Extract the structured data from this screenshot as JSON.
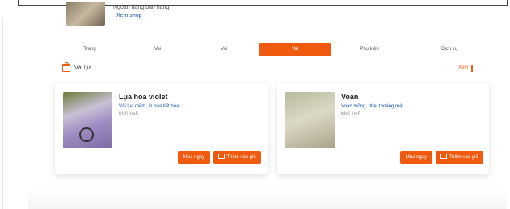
{
  "header": {
    "shop_name": "Ngoan dang ban hang",
    "shop_link": "Xem shop"
  },
  "tabs": [
    {
      "label": "Trang"
    },
    {
      "label": "Vai"
    },
    {
      "label": "Vai"
    },
    {
      "label": "Vai"
    },
    {
      "label": "Phụ kiện"
    },
    {
      "label": "Dịch vụ"
    }
  ],
  "section": {
    "title": "Vải lụa",
    "view_more": "Xem"
  },
  "products": [
    {
      "title": "Lụa hoa violet",
      "desc_line1": "Vải lụa mềm, in họa tiết hoa",
      "desc_line2": "Khổ 1m5",
      "buy_label": "Mua ngay",
      "cart_label": "Thêm vào giỏ"
    },
    {
      "title": "Voan",
      "desc_line1": "Voan mỏng, nhẹ, thoáng mát",
      "desc_line2": "Khổ 1m5",
      "buy_label": "Mua ngay",
      "cart_label": "Thêm vào giỏ"
    }
  ],
  "colors": {
    "accent": "#f05a0f",
    "link": "#1a4fb0"
  }
}
